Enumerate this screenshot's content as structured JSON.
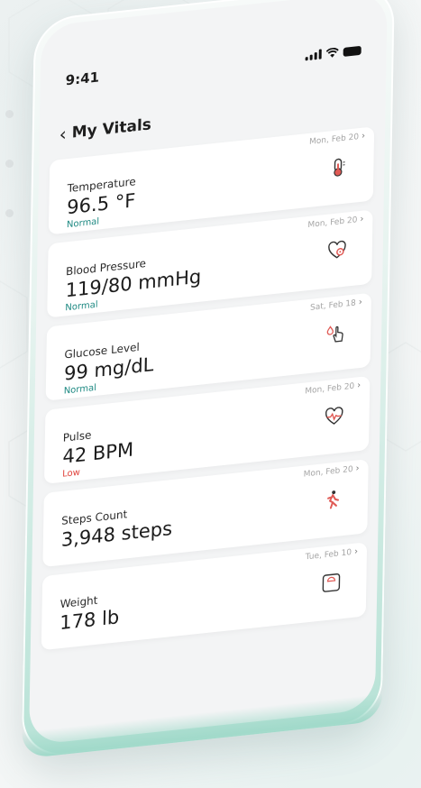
{
  "status_bar": {
    "time": "9:41"
  },
  "header": {
    "back_icon": "chevron-left-icon",
    "title": "My Vitals"
  },
  "vitals": [
    {
      "label": "Temperature",
      "value": "96.5 °F",
      "status": "Normal",
      "status_type": "normal",
      "date": "Mon, Feb 20",
      "icon": "thermometer-icon"
    },
    {
      "label": "Blood Pressure",
      "value": "119/80 mmHg",
      "status": "Normal",
      "status_type": "normal",
      "date": "Mon, Feb 20",
      "icon": "heart-gauge-icon"
    },
    {
      "label": "Glucose Level",
      "value": "99 mg/dL",
      "status": "Normal",
      "status_type": "normal",
      "date": "Sat, Feb 18",
      "icon": "finger-drop-icon"
    },
    {
      "label": "Pulse",
      "value": "42 BPM",
      "status": "Low",
      "status_type": "low",
      "date": "Mon, Feb 20",
      "icon": "heartbeat-icon"
    },
    {
      "label": "Steps Count",
      "value": "3,948 steps",
      "status": "",
      "status_type": "",
      "date": "Mon, Feb 20",
      "icon": "walking-icon"
    },
    {
      "label": "Weight",
      "value": "178 lb",
      "status": "",
      "status_type": "",
      "date": "Tue, Feb 10",
      "icon": "scale-icon"
    }
  ],
  "colors": {
    "normal": "#1f8a83",
    "low": "#e0433c",
    "icon_accent": "#e05a55",
    "phone_mint": "#b7e2d6"
  }
}
